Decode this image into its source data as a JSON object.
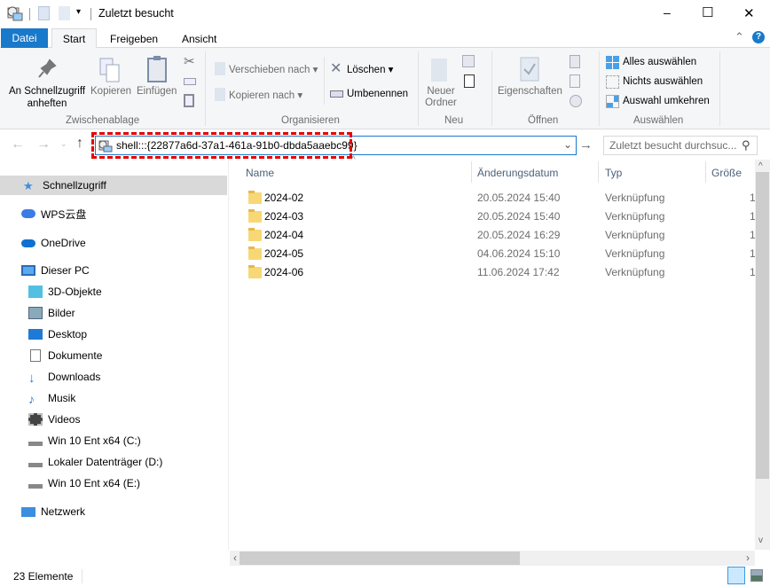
{
  "window": {
    "title": "Zuletzt besucht",
    "controls": {
      "minimize": "–",
      "maximize": "☐",
      "close": "✕"
    }
  },
  "ribbon": {
    "tabs": [
      {
        "label": "Datei",
        "active": false
      },
      {
        "label": "Start",
        "active": true
      },
      {
        "label": "Freigeben",
        "active": false
      },
      {
        "label": "Ansicht",
        "active": false
      }
    ],
    "clipboard": {
      "group": "Zwischenablage",
      "pin_line1": "An Schnellzugriff",
      "pin_line2": "anheften",
      "copy": "Kopieren",
      "paste": "Einfügen"
    },
    "organize": {
      "group": "Organisieren",
      "move": "Verschieben nach",
      "copy_to": "Kopieren nach",
      "delete": "Löschen",
      "rename": "Umbenennen"
    },
    "new": {
      "group": "Neu",
      "folder_line1": "Neuer",
      "folder_line2": "Ordner"
    },
    "open": {
      "group": "Öffnen",
      "properties": "Eigenschaften"
    },
    "select": {
      "group": "Auswählen",
      "all": "Alles auswählen",
      "none": "Nichts auswählen",
      "invert": "Auswahl umkehren"
    }
  },
  "address": {
    "value": "shell:::{22877a6d-37a1-461a-91b0-dbda5aaebc99}",
    "search_placeholder": "Zuletzt besucht durchsuc..."
  },
  "sidebar": {
    "items": [
      {
        "label": "Schnellzugriff",
        "icon": "star-icon",
        "selected": true
      },
      {
        "label": "WPS云盘",
        "icon": "cloud-icon"
      },
      {
        "label": "OneDrive",
        "icon": "onedrive-icon"
      },
      {
        "label": "Dieser PC",
        "icon": "pc-icon"
      },
      {
        "label": "3D-Objekte",
        "icon": "cube-icon"
      },
      {
        "label": "Bilder",
        "icon": "pictures-icon"
      },
      {
        "label": "Desktop",
        "icon": "desktop-icon"
      },
      {
        "label": "Dokumente",
        "icon": "documents-icon"
      },
      {
        "label": "Downloads",
        "icon": "download-icon"
      },
      {
        "label": "Musik",
        "icon": "music-icon"
      },
      {
        "label": "Videos",
        "icon": "video-icon"
      },
      {
        "label": "Win 10 Ent x64 (C:)",
        "icon": "drive-icon"
      },
      {
        "label": "Lokaler Datenträger (D:)",
        "icon": "drive-icon"
      },
      {
        "label": "Win 10 Ent x64 (E:)",
        "icon": "drive-icon"
      },
      {
        "label": "Netzwerk",
        "icon": "network-icon"
      }
    ]
  },
  "columns": {
    "name": "Name",
    "date": "Änderungsdatum",
    "type": "Typ",
    "size": "Größe"
  },
  "files": [
    {
      "name": "2024-02",
      "date": "20.05.2024 15:40",
      "type": "Verknüpfung",
      "size": "1"
    },
    {
      "name": "2024-03",
      "date": "20.05.2024 15:40",
      "type": "Verknüpfung",
      "size": "1"
    },
    {
      "name": "2024-04",
      "date": "20.05.2024 16:29",
      "type": "Verknüpfung",
      "size": "1"
    },
    {
      "name": "2024-05",
      "date": "04.06.2024 15:10",
      "type": "Verknüpfung",
      "size": "1"
    },
    {
      "name": "2024-06",
      "date": "11.06.2024 17:42",
      "type": "Verknüpfung",
      "size": "1"
    }
  ],
  "status": {
    "count": "23 Elemente"
  },
  "colors": {
    "accent": "#1979ca",
    "highlight": "#e60000",
    "selected": "#cce8ff"
  }
}
